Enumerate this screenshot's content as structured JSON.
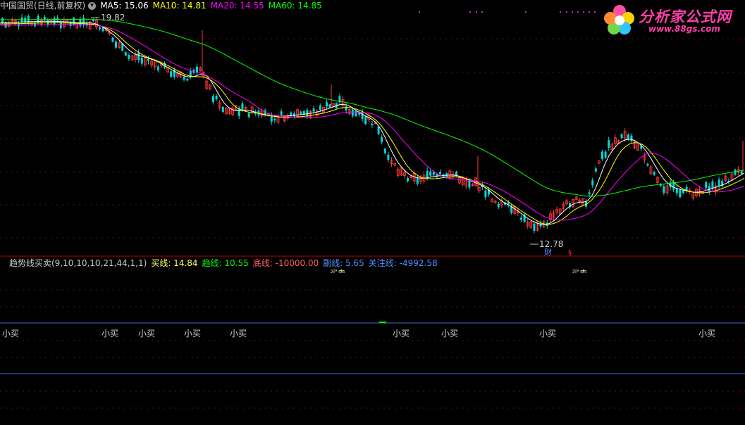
{
  "header": {
    "title": "中国国贸(日线,前复权)",
    "ma_labels": [
      {
        "label": "MA5: 15.06",
        "color": "#ffffff"
      },
      {
        "label": "MA10: 14.81",
        "color": "#ffff00"
      },
      {
        "label": "MA20: 14.55",
        "color": "#ff00ff"
      },
      {
        "label": "MA60: 14.85",
        "color": "#00ff00"
      }
    ]
  },
  "logo": {
    "brand": "分析家公式网",
    "url": "www.88gs.com"
  },
  "annotations": {
    "high": "19.82",
    "low": "12.78",
    "marker_cai": "财",
    "marker_red": "§",
    "buy_sell_a": "买卖",
    "buy_sell_b": "买卖"
  },
  "indicator": {
    "title": "趋势线买卖(9,10,10,10,21,44,1,1)",
    "items": [
      {
        "label": "买线: 14.84",
        "color": "#ffff66"
      },
      {
        "label": "趋线: 10.55",
        "color": "#00ff00"
      },
      {
        "label": "底线: -10000.00",
        "color": "#ff6060"
      },
      {
        "label": "副线: 5.65",
        "color": "#4f8fff"
      },
      {
        "label": "关注线: -4992.58",
        "color": "#4f8fff"
      }
    ],
    "signal_label": "小买",
    "signal_positions": [
      0,
      141,
      193,
      258,
      323,
      554,
      623,
      762,
      988
    ]
  },
  "chart_data": {
    "type": "candlestick",
    "price_high": 19.82,
    "price_low": 12.78,
    "series": [
      {
        "name": "MA5",
        "color": "#ffffff",
        "values": []
      },
      {
        "name": "MA10",
        "color": "#ffff00",
        "values": []
      },
      {
        "name": "MA20",
        "color": "#ff00ff",
        "values": []
      },
      {
        "name": "MA60",
        "color": "#00ff00",
        "values": []
      }
    ]
  },
  "colors": {
    "up": "#ff3a3a",
    "down": "#00d8d8",
    "grid": "#8a1a1a",
    "divider": "#b00000",
    "blue_line": "#3d6fd8"
  }
}
